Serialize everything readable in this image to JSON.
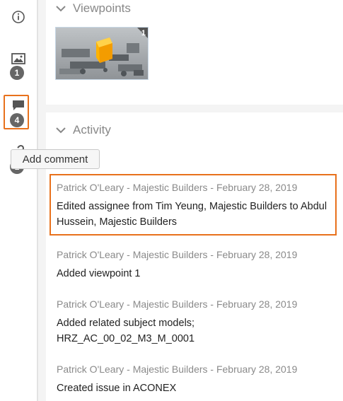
{
  "rail": {
    "items": [
      {
        "icon": "info-circle-icon",
        "badge": ""
      },
      {
        "icon": "image-icon",
        "badge": "1"
      },
      {
        "icon": "comment-icon",
        "badge": "4"
      },
      {
        "icon": "link-icon",
        "badge": "1"
      }
    ]
  },
  "viewpoints": {
    "title": "Viewpoints",
    "thumbnail_count": "1"
  },
  "activity": {
    "title": "Activity",
    "add_comment_label": "Add comment",
    "entries": [
      {
        "meta": "Patrick O'Leary - Majestic Builders - February 28, 2019",
        "text": "Edited assignee from Tim Yeung, Majestic Builders to Abdul Hussein, Majestic Builders"
      },
      {
        "meta": "Patrick O'Leary - Majestic Builders - February 28, 2019",
        "text": "Added viewpoint 1"
      },
      {
        "meta": "Patrick O'Leary - Majestic Builders - February 28, 2019",
        "text": "Added related subject models; HRZ_AC_00_02_M3_M_0001"
      },
      {
        "meta": "Patrick O'Leary - Majestic Builders - February 28, 2019",
        "text": "Created issue in ACONEX"
      }
    ]
  },
  "colors": {
    "highlight": "#e8711c",
    "badge": "#666666",
    "muted_text": "#8a8a8a"
  }
}
